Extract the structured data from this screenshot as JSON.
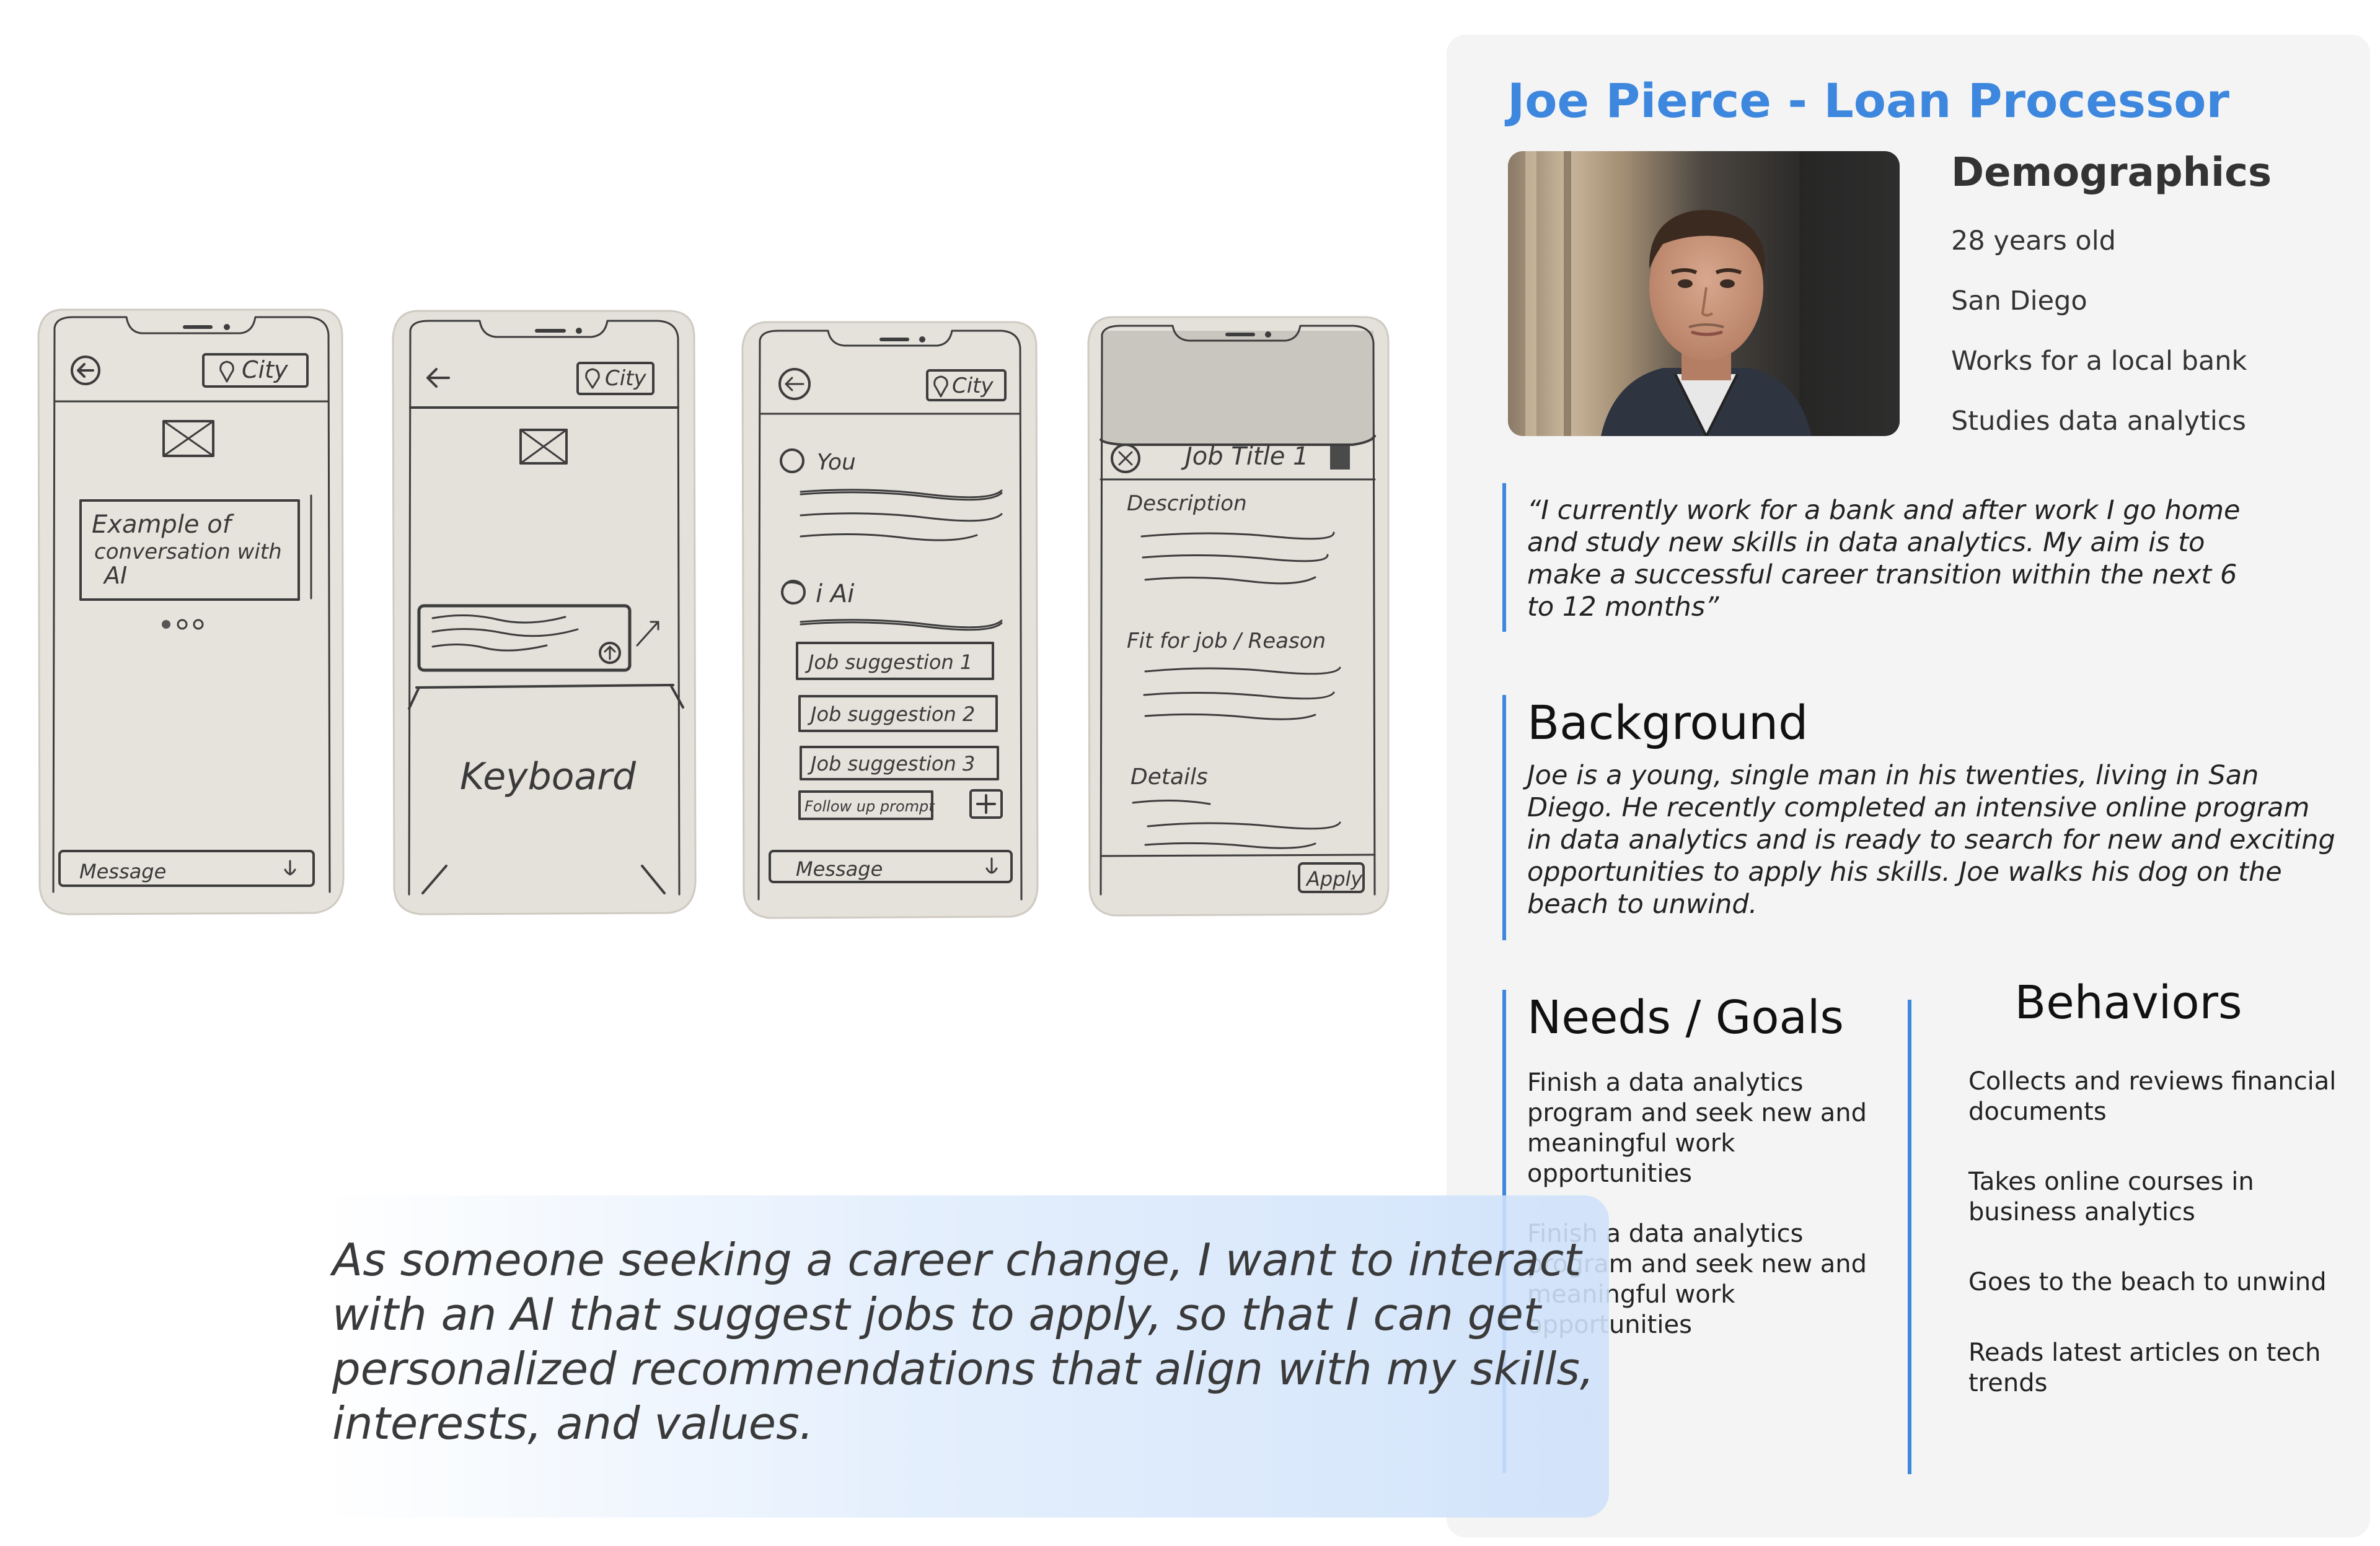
{
  "sketches": {
    "city_label": "City",
    "screen1": {
      "bubble_lines": [
        "Example of",
        "conversation with",
        "AI"
      ],
      "message_label": "Message"
    },
    "screen2": {
      "keyboard_label": "Keyboard"
    },
    "screen3": {
      "you_label": "You",
      "ai_label": "i Ai",
      "suggestions": [
        "Job suggestion 1",
        "Job suggestion 2",
        "Job suggestion 3"
      ],
      "follow_up_label": "Follow up prompt",
      "message_label": "Message"
    },
    "screen4": {
      "job_title": "Job Title 1",
      "description_label": "Description",
      "fit_label": "Fit for job / Reason",
      "details_label": "Details",
      "apply_label": "Apply"
    }
  },
  "persona": {
    "title": "Joe Pierce - Loan Processor",
    "demographics_heading": "Demographics",
    "demographics": [
      "28 years old",
      "San Diego",
      "Works for a local bank",
      "Studies data analytics"
    ],
    "quote": "“I currently work for a bank and after work I go home and study new skills in data analytics. My aim is to make a successful career transition within the next 6 to 12 months”",
    "background_heading": "Background",
    "background": "Joe is a young, single man in his twenties, living in San Diego. He recently completed an intensive online program in data analytics and is ready to search for new and exciting opportunities to apply his skills. Joe walks his dog on the beach to unwind.",
    "needs_heading": "Needs / Goals",
    "needs": [
      "Finish a data analytics program and seek new and meaningful work opportunities",
      "Finish a data analytics program and seek new and meaningful work opportunities"
    ],
    "behaviors_heading": "Behaviors",
    "behaviors": [
      "Collects and reviews financial documents",
      "Takes online courses in business analytics",
      "Goes to the beach to unwind",
      "Reads latest articles on tech trends"
    ]
  },
  "user_story": "As someone seeking a career change, I want to interact with an AI that suggest jobs to apply, so that I can get personalized recommendations that align with my skills, interests, and values."
}
